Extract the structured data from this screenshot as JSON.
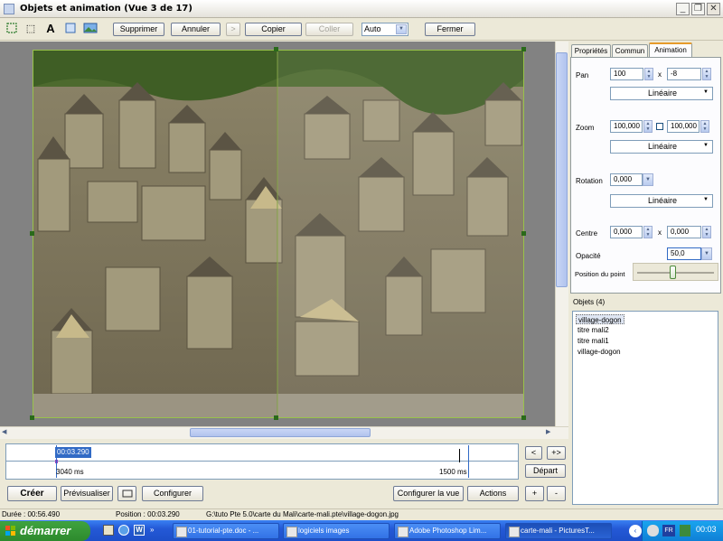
{
  "window": {
    "title": "Objets et animation (Vue 3 de 17)",
    "minimize": "_",
    "restore": "❐",
    "close": "✕"
  },
  "toolbar": {
    "supprimer": "Supprimer",
    "annuler": "Annuler",
    "redo": ">",
    "copier": "Copier",
    "coller": "Coller",
    "zoom_value": "Auto",
    "fermer": "Fermer",
    "text_tool": "A",
    "frame_tool": "⬚",
    "image_tool": "▢"
  },
  "tabs": [
    {
      "label": "Propriétés"
    },
    {
      "label": "Commun"
    },
    {
      "label": "Animation"
    }
  ],
  "animation": {
    "pan_label": "Pan",
    "pan_x": "100",
    "pan_sep": "x",
    "pan_y": "-8",
    "pan_mode": "Linéaire",
    "zoom_label": "Zoom",
    "zoom_x": "100,000",
    "zoom_y": "100,000",
    "zoom_mode": "Linéaire",
    "rotation_label": "Rotation",
    "rotation_value": "0,000",
    "rotation_mode": "Linéaire",
    "centre_label": "Centre",
    "centre_x": "0,000",
    "centre_sep": "x",
    "centre_y": "0,000",
    "opacity_label": "Opacité",
    "opacity_value": "50,0",
    "position_label": "Position du point",
    "position_fraction": 0.45
  },
  "objects": {
    "header": "Objets (4)",
    "items": [
      {
        "label": "village-dogon",
        "selected": true
      },
      {
        "label": "titre mali2",
        "selected": false
      },
      {
        "label": "titre mali1",
        "selected": false
      },
      {
        "label": "village-dogon",
        "selected": false
      }
    ]
  },
  "timeline": {
    "current": "00:03.290",
    "start_ms": "3040 ms",
    "end_ms": "1500 ms",
    "prev": "<",
    "next": "+>",
    "depart": "Départ"
  },
  "bottom_buttons": {
    "creer": "Créer",
    "previsualiser": "Prévisualiser",
    "configurer": "Configurer",
    "configurer_vue": "Configurer la vue",
    "actions": "Actions",
    "plus": "+",
    "minus": "-"
  },
  "status": {
    "duree": "Durée : 00:56.490",
    "position": "Position : 00:03.290",
    "path": "G:\\tuto Pte 5.0\\carte du Mali\\carte-mali.pte\\village-dogon.jpg"
  },
  "taskbar": {
    "start": "démarrer",
    "tasks": [
      {
        "label": "01-tutorial-pte.doc - ..."
      },
      {
        "label": "logiciels images"
      },
      {
        "label": "Adobe Photoshop Lim..."
      },
      {
        "label": "carte-mali - PicturesT..."
      }
    ],
    "lang": "FR",
    "clock": "00:03"
  },
  "colors": {
    "accent": "#e69b2b",
    "selection": "#316ac5",
    "taskbar": "#2459d6"
  }
}
